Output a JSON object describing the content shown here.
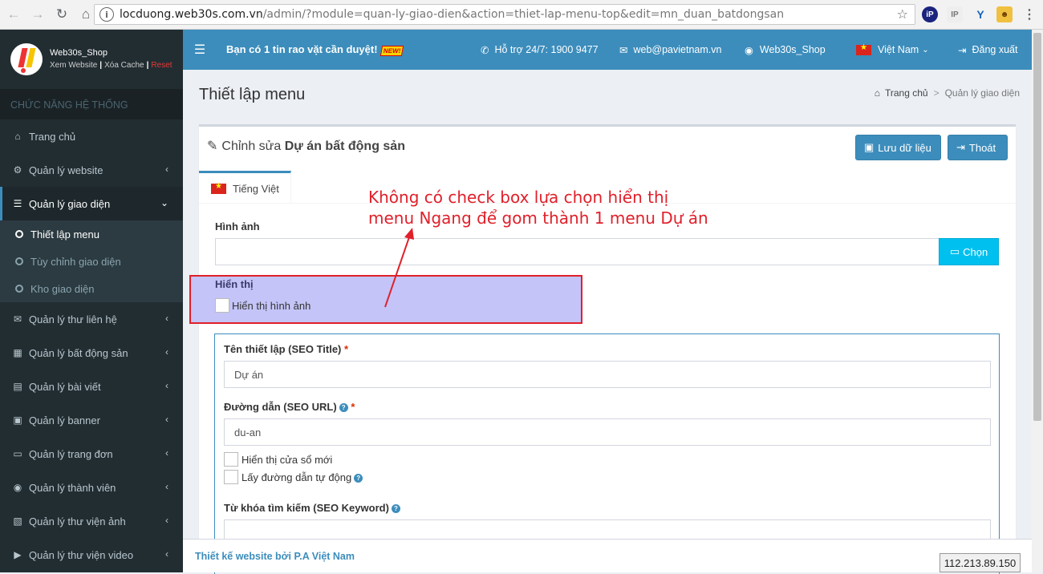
{
  "browser": {
    "url_host": "locduong.web30s.com.vn",
    "url_path": "/admin/?module=quan-ly-giao-dien&action=thiet-lap-menu-top&edit=mn_duan_batdongsan"
  },
  "brand": {
    "name": "Web30s_Shop",
    "link_view": "Xem Website",
    "link_cache": "Xóa Cache",
    "link_reset": "Reset"
  },
  "sidebar": {
    "header": "CHỨC NĂNG HỆ THỐNG",
    "items": [
      {
        "label": "Trang chủ",
        "icon": "home-icon"
      },
      {
        "label": "Quản lý website",
        "icon": "gears-icon"
      },
      {
        "label": "Quản lý giao diện",
        "icon": "bars-icon"
      },
      {
        "label": "Quản lý thư liên hệ",
        "icon": "envelope-icon"
      },
      {
        "label": "Quản lý bất động sản",
        "icon": "building-icon"
      },
      {
        "label": "Quản lý bài viết",
        "icon": "newspaper-icon"
      },
      {
        "label": "Quản lý banner",
        "icon": "image-icon"
      },
      {
        "label": "Quản lý trang đơn",
        "icon": "laptop-icon"
      },
      {
        "label": "Quản lý thành viên",
        "icon": "user-circle-icon"
      },
      {
        "label": "Quản lý thư viện ảnh",
        "icon": "photo-icon"
      },
      {
        "label": "Quản lý thư viện video",
        "icon": "video-icon"
      }
    ],
    "subitems": [
      {
        "label": "Thiết lập menu"
      },
      {
        "label": "Tùy chỉnh giao diện"
      },
      {
        "label": "Kho giao diện"
      }
    ]
  },
  "topbar": {
    "notice": "Bạn có 1 tin rao vặt cần duyệt!",
    "new_badge": "NEW!",
    "support": "Hỗ trợ 24/7: 1900 9477",
    "email": "web@pavietnam.vn",
    "user": "Web30s_Shop",
    "language": "Việt Nam",
    "logout": "Đăng xuất"
  },
  "page": {
    "title": "Thiết lập menu",
    "breadcrumb_home": "Trang chủ",
    "breadcrumb_current": "Quản lý giao diện"
  },
  "form": {
    "edit_prefix": "Chỉnh sửa",
    "edit_name": "Dự án bất động sản",
    "save_button": "Lưu dữ liệu",
    "exit_button": "Thoát",
    "tab": "Tiếng Việt",
    "image_label": "Hình ảnh",
    "image_value": "",
    "choose_button": "Chọn",
    "display_label": "Hiển thị",
    "display_image_check": "Hiển thị hình ảnh",
    "seo_title_label": "Tên thiết lập (SEO Title)",
    "seo_title_value": "Dự án",
    "seo_url_label": "Đường dẫn (SEO URL)",
    "seo_url_value": "du-an",
    "new_window_check": "Hiển thị cửa sổ mới",
    "auto_url_check": "Lấy đường dẫn tự động",
    "keyword_label": "Từ khóa tìm kiếm (SEO Keyword)",
    "keyword_value": "",
    "required_mark": "*"
  },
  "annotation": {
    "line1": "Không có check box lựa chọn hiển thị",
    "line2": "menu Ngang để gom thành 1 menu Dự án",
    "color": "#e0202a"
  },
  "footer": {
    "text": "Thiết kế website bởi P.A Việt Nam",
    "ip": "112.213.89.150"
  },
  "colors": {
    "primary": "#3c8dbc",
    "sidebar": "#222d32",
    "info": "#00c0ef",
    "highlight": "#c4c4f8"
  }
}
